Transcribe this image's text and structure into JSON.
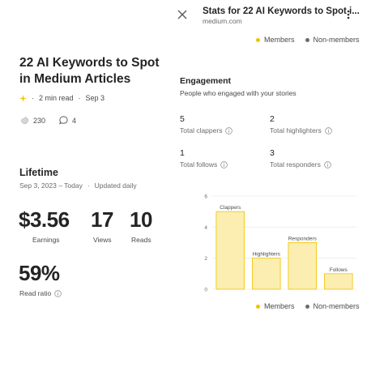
{
  "header": {
    "title": "Stats for 22 AI Keywords to Spot i...",
    "url": "medium.com"
  },
  "legend": {
    "members": "Members",
    "non_members": "Non-members",
    "members_color": "#f2c200",
    "non_members_color": "#6b6b6b"
  },
  "article": {
    "title": "22 AI Keywords to Spot in Medium Articles",
    "read_time": "2 min read",
    "date": "Sep 3",
    "claps": "230",
    "comments": "4"
  },
  "lifetime": {
    "heading": "Lifetime",
    "range": "Sep 3, 2023 – Today",
    "update": "Updated daily",
    "earnings_value": "$3.56",
    "earnings_label": "Earnings",
    "views_value": "17",
    "views_label": "Views",
    "reads_value": "10",
    "reads_label": "Reads",
    "read_ratio_value": "59%",
    "read_ratio_label": "Read ratio"
  },
  "engagement": {
    "heading": "Engagement",
    "subtitle": "People who engaged with your stories",
    "clappers_value": "5",
    "clappers_label": "Total clappers",
    "highlighters_value": "2",
    "highlighters_label": "Total highlighters",
    "follows_value": "1",
    "follows_label": "Total follows",
    "responders_value": "3",
    "responders_label": "Total responders"
  },
  "chart_data": {
    "type": "bar",
    "categories": [
      "Clappers",
      "Highlighters",
      "Responders",
      "Follows"
    ],
    "values": [
      5,
      2,
      3,
      1
    ],
    "yticks": [
      "0",
      "2",
      "4",
      "6"
    ],
    "ylim": [
      0,
      6
    ],
    "bar_color": "#fbeeb0",
    "bar_stroke": "#f2c200",
    "grid": true
  }
}
